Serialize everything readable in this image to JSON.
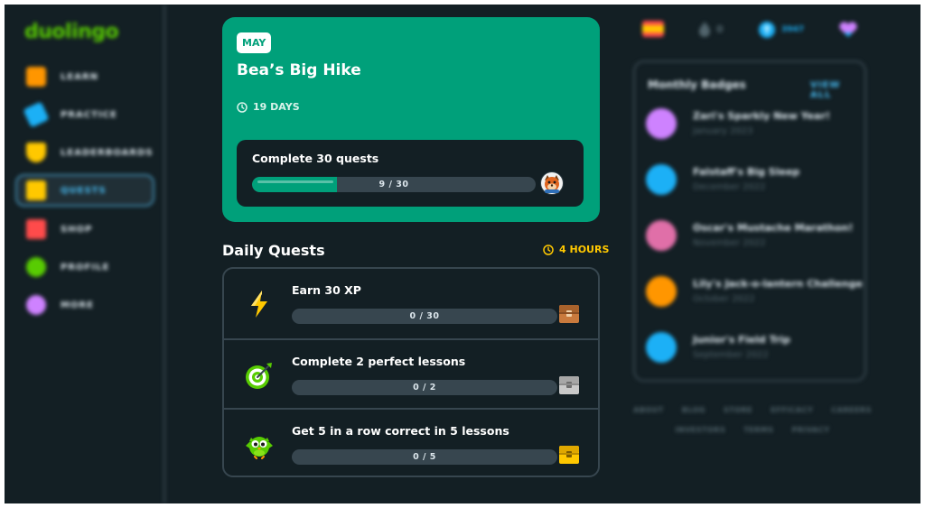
{
  "app": {
    "logo": "duolingo"
  },
  "sidebar": {
    "items": [
      {
        "label": "LEARN",
        "icon": "home-icon",
        "color": "#ff9600"
      },
      {
        "label": "PRACTICE",
        "icon": "dumbbell-icon",
        "color": "#1cb0f6"
      },
      {
        "label": "LEADERBOARDS",
        "icon": "shield-icon",
        "color": "#ffc800"
      },
      {
        "label": "QUESTS",
        "icon": "chest-icon",
        "color": "#ffc800",
        "active": true
      },
      {
        "label": "SHOP",
        "icon": "shop-icon",
        "color": "#ff4b4b"
      },
      {
        "label": "PROFILE",
        "icon": "avatar-icon",
        "color": "#58cc02"
      },
      {
        "label": "MORE",
        "icon": "more-icon",
        "color": "#ce82ff"
      }
    ]
  },
  "monthly_challenge": {
    "month": "MAY",
    "title": "Bea’s Big Hike",
    "days_left": "19 DAYS",
    "quest": {
      "title": "Complete 30 quests",
      "progress_text": "9 / 30",
      "progress": 0.3
    }
  },
  "daily_quests": {
    "title": "Daily Quests",
    "timer": "4 HOURS",
    "items": [
      {
        "title": "Earn 30 XP",
        "progress_text": "0 / 30",
        "progress": 0,
        "icon": "lightning-icon",
        "chest": "bronze-chest-icon"
      },
      {
        "title": "Complete 2 perfect lessons",
        "progress_text": "0 / 2",
        "progress": 0,
        "icon": "target-icon",
        "chest": "silver-chest-icon"
      },
      {
        "title": "Get 5 in a row correct in 5 lessons",
        "progress_text": "0 / 5",
        "progress": 0,
        "icon": "owl-icon",
        "chest": "gold-chest-icon"
      }
    ]
  },
  "top_stats": {
    "streak": "0",
    "gems": "3947"
  },
  "monthly_badges": {
    "title": "Monthly Badges",
    "view_all": "VIEW ALL",
    "items": [
      {
        "name": "Zari's Sparkly New Year!",
        "date": "January 2023",
        "color": "#ce82ff"
      },
      {
        "name": "Falstaff's Big Sleep",
        "date": "December 2022",
        "color": "#1cb0f6"
      },
      {
        "name": "Oscar's Mustache Marathon!",
        "date": "November 2022",
        "color": "#e06fa8"
      },
      {
        "name": "Lily's Jack-o-lantern Challenge",
        "date": "October 2022",
        "color": "#ff9600"
      },
      {
        "name": "Junior's Field Trip",
        "date": "September 2022",
        "color": "#1cb0f6"
      }
    ]
  },
  "footer": {
    "row1": [
      "ABOUT",
      "BLOG",
      "STORE",
      "EFFICACY",
      "CAREERS"
    ],
    "row2": [
      "INVESTORS",
      "TERMS",
      "PRIVACY"
    ]
  },
  "colors": {
    "background": "#131f24",
    "card_green": "#00a07a",
    "border": "#37464f",
    "accent_blue": "#49c0f8",
    "timer_gold": "#ffc800"
  }
}
